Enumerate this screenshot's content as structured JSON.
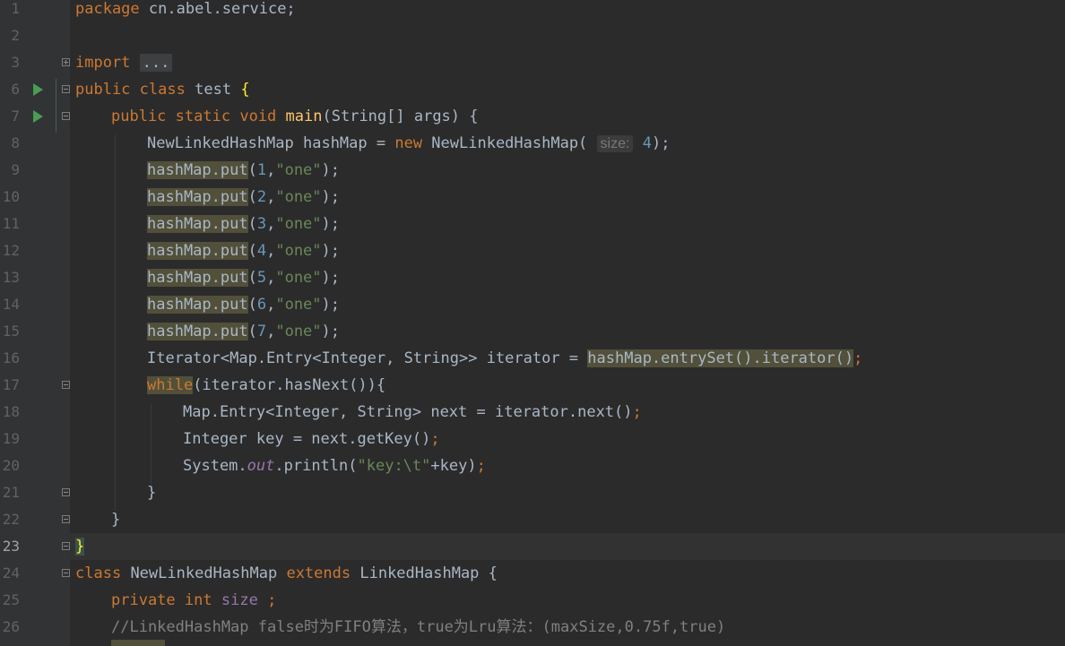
{
  "editor": {
    "current_line": "23",
    "lines": [
      {
        "num": "1",
        "text": "package cn.abel.service;"
      },
      {
        "num": "2",
        "text": ""
      },
      {
        "num": "3",
        "text": "import ..."
      },
      {
        "num": "6",
        "text": "public class test {"
      },
      {
        "num": "7",
        "text": "public static void main(String[] args) {"
      },
      {
        "num": "8",
        "text": "NewLinkedHashMap hashMap = new NewLinkedHashMap( size: 4);"
      },
      {
        "num": "9",
        "text": "hashMap.put(1,\"one\");"
      },
      {
        "num": "10",
        "text": "hashMap.put(2,\"one\");"
      },
      {
        "num": "11",
        "text": "hashMap.put(3,\"one\");"
      },
      {
        "num": "12",
        "text": "hashMap.put(4,\"one\");"
      },
      {
        "num": "13",
        "text": "hashMap.put(5,\"one\");"
      },
      {
        "num": "14",
        "text": "hashMap.put(6,\"one\");"
      },
      {
        "num": "15",
        "text": "hashMap.put(7,\"one\");"
      },
      {
        "num": "16",
        "text": "Iterator<Map.Entry<Integer, String>> iterator = hashMap.entrySet().iterator();"
      },
      {
        "num": "17",
        "text": "while(iterator.hasNext()){"
      },
      {
        "num": "18",
        "text": "Map.Entry<Integer, String> next = iterator.next();"
      },
      {
        "num": "19",
        "text": "Integer key = next.getKey();"
      },
      {
        "num": "20",
        "text": "System.out.println(\"key:\\t\"+key);"
      },
      {
        "num": "21",
        "text": "}"
      },
      {
        "num": "22",
        "text": "}"
      },
      {
        "num": "23",
        "text": "}"
      },
      {
        "num": "24",
        "text": "class NewLinkedHashMap extends LinkedHashMap {"
      },
      {
        "num": "25",
        "text": "private int size ;"
      },
      {
        "num": "26",
        "text": "//LinkedHashMap false时为FIFO算法，true为Lru算法：(maxSize,0.75f,true)"
      }
    ],
    "tokens": {
      "package": "package",
      "pkg_name": "cn.abel.service;",
      "import": "import",
      "import_dots": "...",
      "public": "public",
      "class": "class",
      "class_name": "test",
      "open_brace": "{",
      "static": "static",
      "void": "void",
      "main": "main",
      "main_args": "(String[] args) {",
      "nlhm_decl": "NewLinkedHashMap hashMap = ",
      "new": "new",
      "nlhm_ctor": " NewLinkedHashMap(",
      "hint_size": "size:",
      "four": "4",
      "close_paren_semi": ");",
      "hashmap_put": "hashMap.put",
      "open_paren": "(",
      "comma": ",",
      "str_one": "\"one\"",
      "iter_decl": "Iterator<Map.Entry<Integer, String>> iterator = ",
      "entryset_call": "hashMap.entrySet().iterator()",
      "semi": ";",
      "while": "while",
      "while_rest": "(iterator.hasNext()){",
      "entry_decl": "Map.Entry<Integer, String> next = iterator.next()",
      "key_decl": "Integer key = next.getKey()",
      "system": "System.",
      "out": "out",
      "println": ".println(",
      "str_key": "\"key:\\t\"",
      "println_rest": "+key)",
      "close_brace": "}",
      "class_nlhm": "NewLinkedHashMap",
      "extends": "extends",
      "lhm": "LinkedHashMap {",
      "private": "private",
      "int": "int",
      "size_field": "size",
      "space_semi": " ;",
      "comment_26": "//LinkedHashMap false时为FIFO算法，true为Lru算法：(maxSize,0.75f,true)",
      "n1": "1",
      "n2": "2",
      "n3": "3",
      "n4": "4",
      "n5": "5",
      "n6": "6",
      "n7": "7"
    }
  },
  "colors": {
    "background": "#2b2b2b",
    "gutter": "#313335",
    "keyword": "#cc7832",
    "string": "#6a8759",
    "number": "#6897bb",
    "method": "#ffc66d",
    "field": "#9876aa",
    "comment": "#808080",
    "run_icon": "#499c54"
  }
}
